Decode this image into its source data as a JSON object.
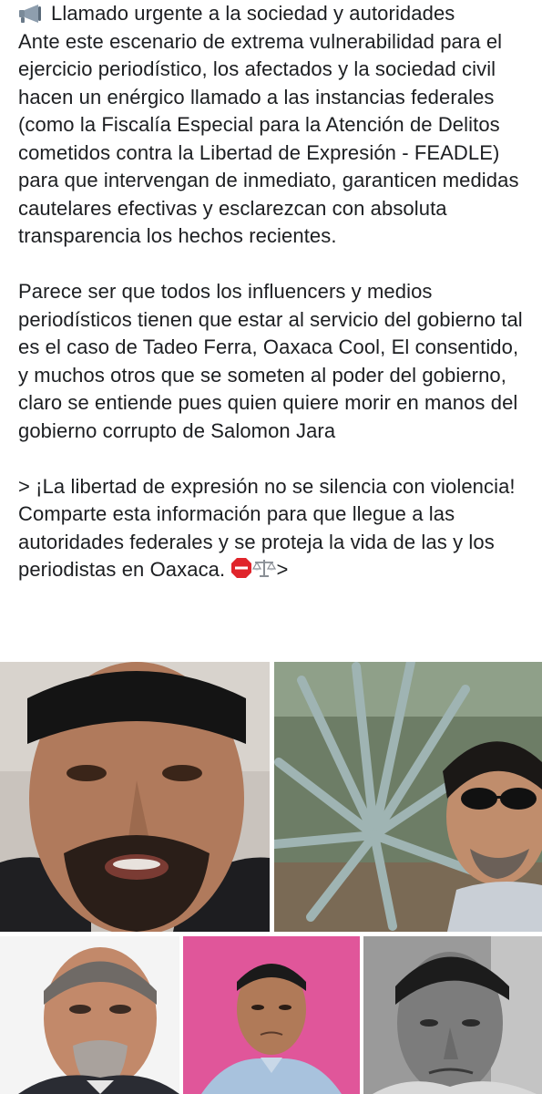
{
  "post": {
    "heading": "Llamado urgente a la sociedad y autoridades",
    "paragraph1": "Ante este escenario de extrema vulnerabilidad para el ejercicio periodístico, los afectados y la sociedad civil hacen un enérgico llamado a las instancias federales (como la Fiscalía Especial para la Atención de Delitos cometidos contra la Libertad de Expresión - FEADLE) para que intervengan de inmediato, garanticen medidas cautelares efectivas y esclarezcan con absoluta transparencia los hechos recientes.",
    "paragraph2": "Parece ser que todos los influencers y medios periodísticos tienen que estar al servicio del gobierno tal es el caso de Tadeo Ferra, Oaxaca Cool, El consentido, y muchos otros que se someten al poder del gobierno, claro se entiende pues quien quiere morir en manos del gobierno corrupto de Salomon Jara",
    "paragraph3": "> ¡La libertad de expresión no se silencia con violencia! Comparte esta información para que llegue a las autoridades federales y se proteja la vida de las y los periodistas en Oaxaca.",
    "paragraph3_tail": ">",
    "icons": [
      "megaphone-icon",
      "stop-sign-icon",
      "scales-icon"
    ]
  },
  "photos": [
    {
      "name": "photo-man-talking",
      "content": "man with goatee speaking to camera"
    },
    {
      "name": "photo-man-agave",
      "content": "man in sunglasses beside agave plant"
    },
    {
      "name": "photo-man-suit",
      "content": "older man with grey goatee in suit"
    },
    {
      "name": "photo-man-pink-bg",
      "content": "man in blue shirt on pink background"
    },
    {
      "name": "photo-man-bw",
      "content": "black and white portrait of man"
    }
  ]
}
